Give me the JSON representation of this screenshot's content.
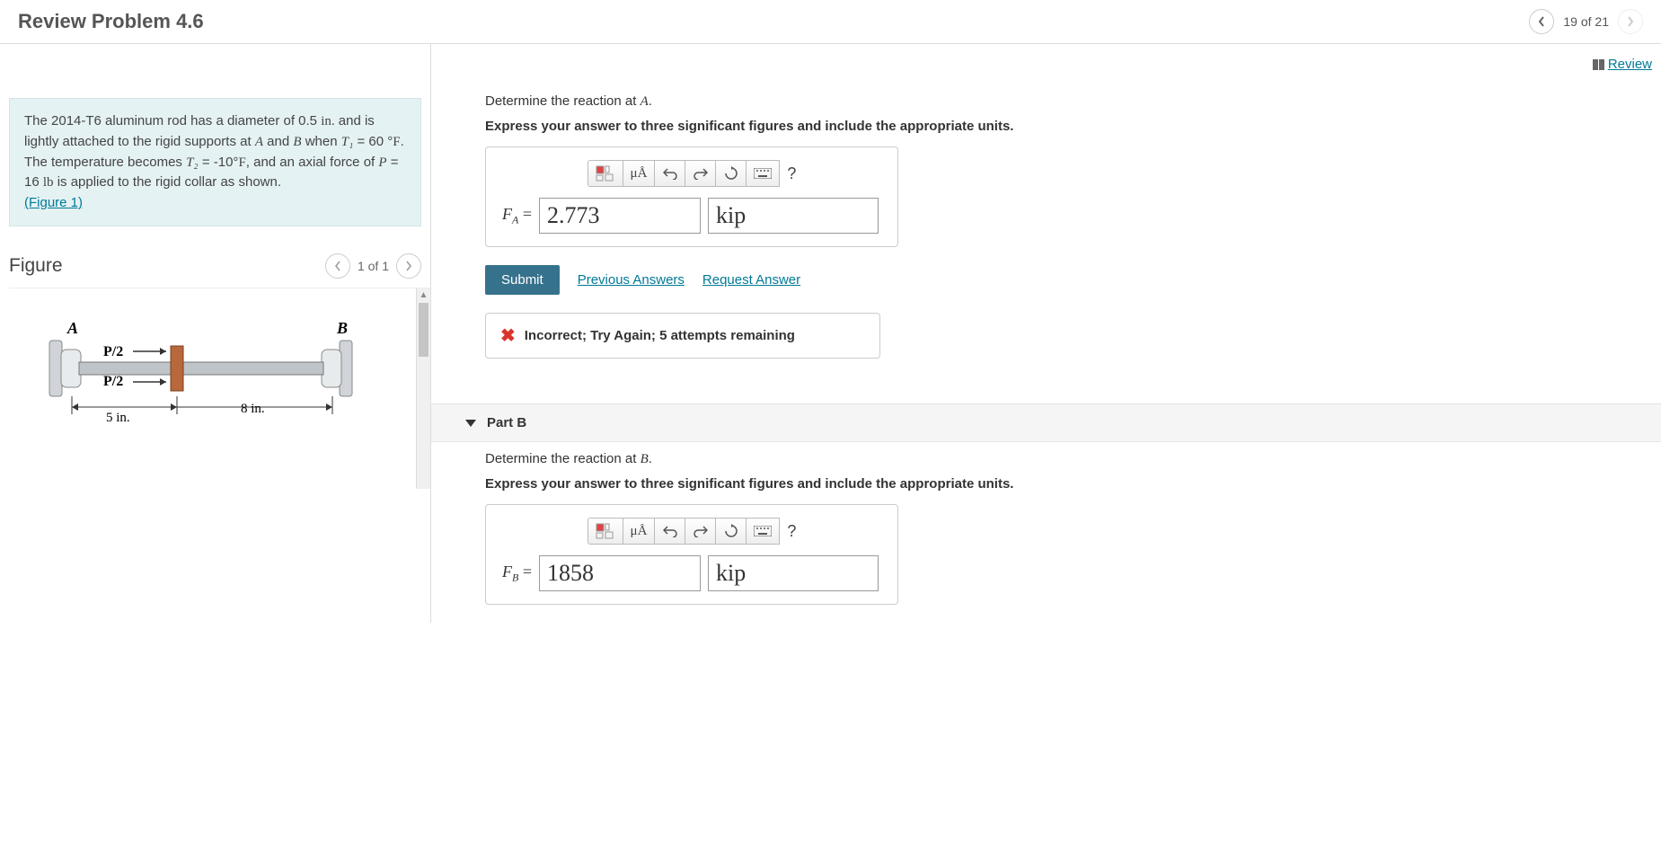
{
  "header": {
    "title": "Review Problem 4.6",
    "position": "19 of 21"
  },
  "review_link": "Review",
  "problem": {
    "text_prefix": "The 2014-T6 aluminum rod has a diameter of 0.5 ",
    "unit1": "in.",
    "text_2": " and is lightly attached to the rigid supports at ",
    "A": "A",
    "text_3": " and ",
    "B": "B",
    "text_4": " when ",
    "T1": "T₁",
    "text_5": " = 60 °",
    "F1": "F",
    "text_6": ". The temperature becomes ",
    "T2": "T₂",
    "text_7": " = -10°",
    "F2": "F",
    "text_8": ", and an axial force of ",
    "P": "P",
    "text_9": " = 16 ",
    "lb": "lb",
    "text_10": " is applied to the rigid collar as shown.",
    "figure_link": "(Figure 1)"
  },
  "figure": {
    "title": "Figure",
    "position": "1 of 1",
    "labels": {
      "A": "A",
      "B": "B",
      "P2a": "P/2",
      "P2b": "P/2",
      "d1": "5 in.",
      "d2": "8 in."
    }
  },
  "partA": {
    "prompt_prefix": "Determine the reaction at ",
    "prompt_var": "A",
    "prompt_suffix": ".",
    "instruction": "Express your answer to three significant figures and include the appropriate units.",
    "toolbar": {
      "mu": "μÅ",
      "help": "?"
    },
    "var_label_base": "F",
    "var_label_sub": "A",
    "equals": " = ",
    "value": "2.773",
    "unit": "kip",
    "submit": "Submit",
    "previous": "Previous Answers",
    "request": "Request Answer",
    "feedback": "Incorrect; Try Again; 5 attempts remaining"
  },
  "partB": {
    "header": "Part B",
    "prompt_prefix": "Determine the reaction at ",
    "prompt_var": "B",
    "prompt_suffix": ".",
    "instruction": "Express your answer to three significant figures and include the appropriate units.",
    "toolbar": {
      "mu": "μÅ",
      "help": "?"
    },
    "var_label_base": "F",
    "var_label_sub": "B",
    "equals": " = ",
    "value": "1858",
    "unit": "kip"
  }
}
